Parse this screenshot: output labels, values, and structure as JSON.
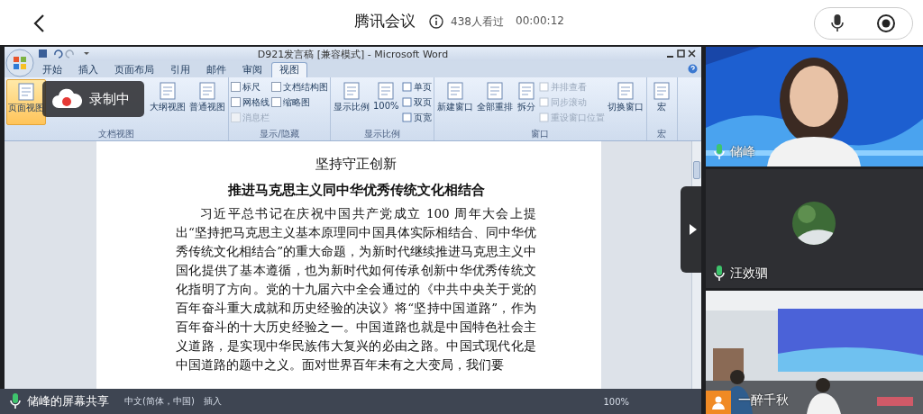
{
  "topbar": {
    "title": "腾讯会议",
    "viewers": "438人看过",
    "elapsed": "00:00:12"
  },
  "recording": {
    "label": "录制中"
  },
  "word": {
    "title": "D921发言稿 [兼容模式] - Microsoft Word",
    "tabs": [
      {
        "label": "开始",
        "selected": false
      },
      {
        "label": "插入",
        "selected": false
      },
      {
        "label": "页面布局",
        "selected": false
      },
      {
        "label": "引用",
        "selected": false
      },
      {
        "label": "邮件",
        "selected": false
      },
      {
        "label": "审阅",
        "selected": false
      },
      {
        "label": "视图",
        "selected": true
      }
    ],
    "ribbon": [
      {
        "label": "文档视图",
        "items": [
          {
            "kind": "large",
            "label": "页面视图",
            "selected": true
          },
          {
            "kind": "gap"
          },
          {
            "kind": "large",
            "label": "大纲视图",
            "selected": false
          },
          {
            "kind": "large",
            "label": "普通视图",
            "selected": false
          }
        ]
      },
      {
        "label": "显示/隐藏",
        "items": [
          {
            "kind": "check",
            "label": "标尺",
            "checked": false,
            "disabled": false
          },
          {
            "kind": "check",
            "label": "网格线",
            "checked": false,
            "disabled": false
          },
          {
            "kind": "check",
            "label": "消息栏",
            "checked": false,
            "disabled": true
          },
          {
            "kind": "check",
            "label": "文档结构图",
            "checked": false,
            "disabled": false
          },
          {
            "kind": "check",
            "label": "缩略图",
            "checked": false,
            "disabled": false
          }
        ]
      },
      {
        "label": "显示比例",
        "items": [
          {
            "kind": "large",
            "label": "显示比例"
          },
          {
            "kind": "large",
            "label": "100%"
          },
          {
            "kind": "small",
            "label": "单页",
            "disabled": false
          },
          {
            "kind": "small",
            "label": "双页",
            "disabled": false
          },
          {
            "kind": "small",
            "label": "页宽",
            "disabled": false
          }
        ]
      },
      {
        "label": "窗口",
        "items": [
          {
            "kind": "large",
            "label": "新建窗口"
          },
          {
            "kind": "large",
            "label": "全部重排"
          },
          {
            "kind": "large",
            "label": "拆分"
          },
          {
            "kind": "small",
            "label": "并排查看",
            "disabled": true
          },
          {
            "kind": "small",
            "label": "同步滚动",
            "disabled": true
          },
          {
            "kind": "small",
            "label": "重设窗口位置",
            "disabled": true
          },
          {
            "kind": "large",
            "label": "切换窗口"
          }
        ]
      },
      {
        "label": "宏",
        "items": [
          {
            "kind": "large",
            "label": "宏"
          }
        ]
      }
    ],
    "document": {
      "heading": "坚持守正创新",
      "subheading": "推进马克思主义同中华优秀传统文化相结合",
      "paragraph": "习近平总书记在庆祝中国共产党成立 100 周年大会上提出“坚持把马克思主义基本原理同中国具体实际相结合、同中华优秀传统文化相结合”的重大命题，为新时代继续推进马克思主义中国化提供了基本遵循，也为新时代如何传承创新中华优秀传统文化指明了方向。党的十九届六中全会通过的《中共中央关于党的百年奋斗重大成就和历史经验的决议》将“坚持中国道路”，作为百年奋斗的十大历史经验之一。中国道路也就是中国特色社会主义道路，是实现中华民族伟大复兴的必由之路。中国式现代化是中国道路的题中之义。面对世界百年未有之大变局，我们要"
    },
    "status": [
      "中文(简体，中国)",
      "插入"
    ],
    "zoom": "100%"
  },
  "share": {
    "label": "储峰的屏幕共享"
  },
  "participants": [
    {
      "name": "储峰",
      "kind": "video"
    },
    {
      "name": "汪效驷",
      "kind": "avatar"
    },
    {
      "name": "一醉千秋",
      "kind": "room"
    }
  ]
}
